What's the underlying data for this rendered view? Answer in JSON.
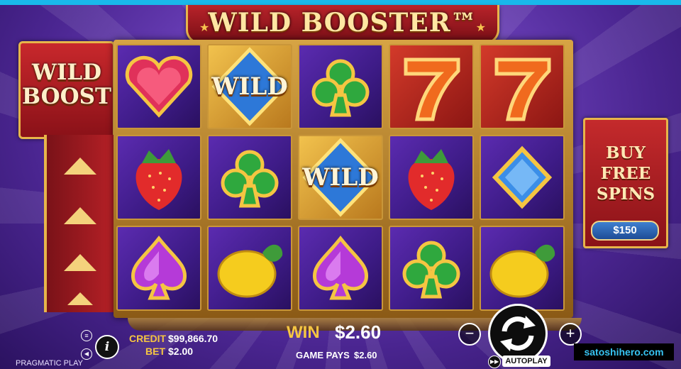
{
  "game": {
    "title": "WILD BOOSTER™",
    "wild_boost_label": "WILD BOOST",
    "wild_label": "WILD",
    "buy_free_spins": {
      "label_line1": "BUY",
      "label_line2": "FREE",
      "label_line3": "SPINS",
      "price": "$150"
    }
  },
  "reels": [
    [
      "heart-gem",
      "strawberry",
      "spade-gem"
    ],
    [
      "wild",
      "club-gem",
      "lemon"
    ],
    [
      "club-gem",
      "wild",
      "spade-gem"
    ],
    [
      "seven",
      "strawberry",
      "club-gem"
    ],
    [
      "seven",
      "diamond-gem",
      "lemon"
    ]
  ],
  "footer": {
    "credit_label": "CREDIT",
    "credit_value": "$99,866.70",
    "bet_label": "BET",
    "bet_value": "$2.00",
    "win_label": "WIN",
    "win_value": "$2.60",
    "game_pays_label": "GAME PAYS",
    "game_pays_value": "$2.60",
    "minus": "−",
    "plus": "+",
    "autoplay_label": "AUTOPLAY",
    "provider": "PRAGMATIC PLAY",
    "watermark": "satoshihero.com"
  },
  "colors": {
    "accent_gold": "#f5c542",
    "frame_red": "#b8232a",
    "background_purple": "#6a3fb8",
    "watermark_blue": "#37c4f3"
  }
}
